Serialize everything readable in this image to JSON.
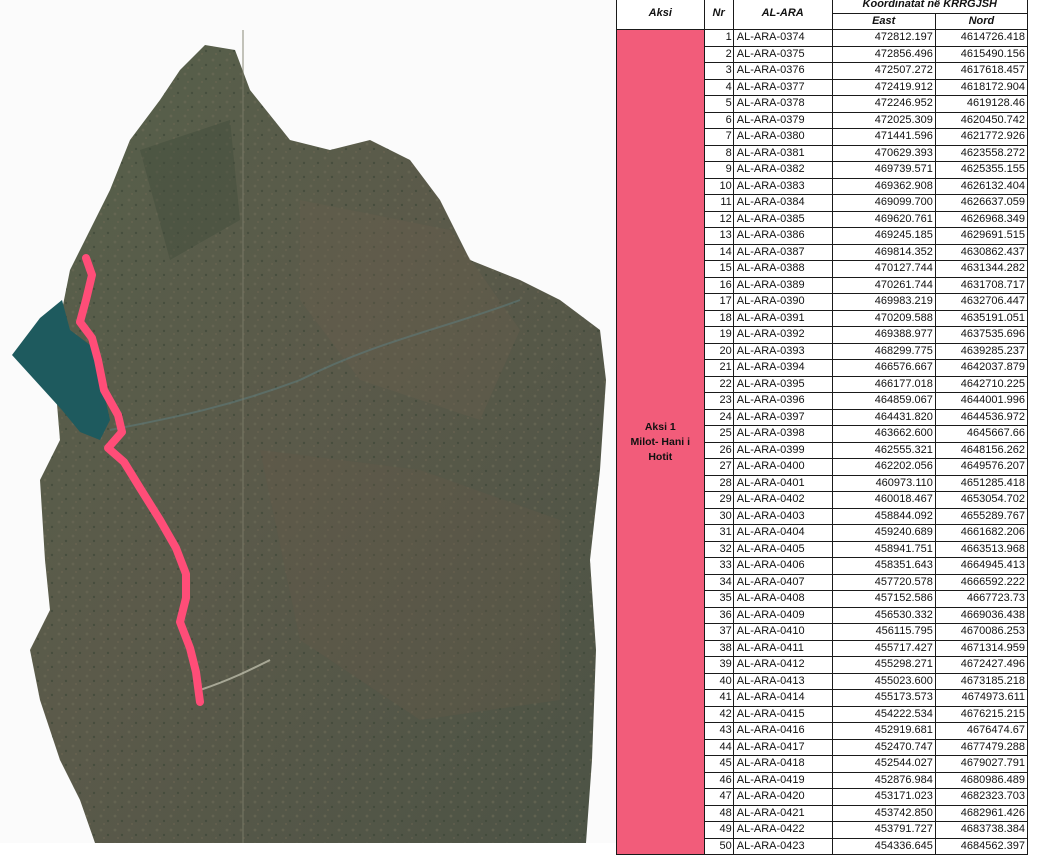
{
  "table": {
    "headers": {
      "aksi": "Aksi",
      "nr": "Nr",
      "ara": "AL-ARA",
      "coords": "Koordinatat në KRRGJSH",
      "east": "East",
      "nord": "Nord"
    },
    "group": {
      "line1": "Aksi 1",
      "line2": "Milot- Hani i",
      "line3": "Hotit"
    },
    "rows": [
      {
        "nr": "1",
        "id": "AL-ARA-0374",
        "east": "472812.197",
        "nord": "4614726.418"
      },
      {
        "nr": "2",
        "id": "AL-ARA-0375",
        "east": "472856.496",
        "nord": "4615490.156"
      },
      {
        "nr": "3",
        "id": "AL-ARA-0376",
        "east": "472507.272",
        "nord": "4617618.457"
      },
      {
        "nr": "4",
        "id": "AL-ARA-0377",
        "east": "472419.912",
        "nord": "4618172.904"
      },
      {
        "nr": "5",
        "id": "AL-ARA-0378",
        "east": "472246.952",
        "nord": "4619128.46"
      },
      {
        "nr": "6",
        "id": "AL-ARA-0379",
        "east": "472025.309",
        "nord": "4620450.742"
      },
      {
        "nr": "7",
        "id": "AL-ARA-0380",
        "east": "471441.596",
        "nord": "4621772.926"
      },
      {
        "nr": "8",
        "id": "AL-ARA-0381",
        "east": "470629.393",
        "nord": "4623558.272"
      },
      {
        "nr": "9",
        "id": "AL-ARA-0382",
        "east": "469739.571",
        "nord": "4625355.155"
      },
      {
        "nr": "10",
        "id": "AL-ARA-0383",
        "east": "469362.908",
        "nord": "4626132.404"
      },
      {
        "nr": "11",
        "id": "AL-ARA-0384",
        "east": "469099.700",
        "nord": "4626637.059"
      },
      {
        "nr": "12",
        "id": "AL-ARA-0385",
        "east": "469620.761",
        "nord": "4626968.349"
      },
      {
        "nr": "13",
        "id": "AL-ARA-0386",
        "east": "469245.185",
        "nord": "4629691.515"
      },
      {
        "nr": "14",
        "id": "AL-ARA-0387",
        "east": "469814.352",
        "nord": "4630862.437"
      },
      {
        "nr": "15",
        "id": "AL-ARA-0388",
        "east": "470127.744",
        "nord": "4631344.282"
      },
      {
        "nr": "16",
        "id": "AL-ARA-0389",
        "east": "470261.744",
        "nord": "4631708.717"
      },
      {
        "nr": "17",
        "id": "AL-ARA-0390",
        "east": "469983.219",
        "nord": "4632706.447"
      },
      {
        "nr": "18",
        "id": "AL-ARA-0391",
        "east": "470209.588",
        "nord": "4635191.051"
      },
      {
        "nr": "19",
        "id": "AL-ARA-0392",
        "east": "469388.977",
        "nord": "4637535.696"
      },
      {
        "nr": "20",
        "id": "AL-ARA-0393",
        "east": "468299.775",
        "nord": "4639285.237"
      },
      {
        "nr": "21",
        "id": "AL-ARA-0394",
        "east": "466576.667",
        "nord": "4642037.879"
      },
      {
        "nr": "22",
        "id": "AL-ARA-0395",
        "east": "466177.018",
        "nord": "4642710.225"
      },
      {
        "nr": "23",
        "id": "AL-ARA-0396",
        "east": "464859.067",
        "nord": "4644001.996"
      },
      {
        "nr": "24",
        "id": "AL-ARA-0397",
        "east": "464431.820",
        "nord": "4644536.972"
      },
      {
        "nr": "25",
        "id": "AL-ARA-0398",
        "east": "463662.600",
        "nord": "4645667.66"
      },
      {
        "nr": "26",
        "id": "AL-ARA-0399",
        "east": "462555.321",
        "nord": "4648156.262"
      },
      {
        "nr": "27",
        "id": "AL-ARA-0400",
        "east": "462202.056",
        "nord": "4649576.207"
      },
      {
        "nr": "28",
        "id": "AL-ARA-0401",
        "east": "460973.110",
        "nord": "4651285.418"
      },
      {
        "nr": "29",
        "id": "AL-ARA-0402",
        "east": "460018.467",
        "nord": "4653054.702"
      },
      {
        "nr": "30",
        "id": "AL-ARA-0403",
        "east": "458844.092",
        "nord": "4655289.767"
      },
      {
        "nr": "31",
        "id": "AL-ARA-0404",
        "east": "459240.689",
        "nord": "4661682.206"
      },
      {
        "nr": "32",
        "id": "AL-ARA-0405",
        "east": "458941.751",
        "nord": "4663513.968"
      },
      {
        "nr": "33",
        "id": "AL-ARA-0406",
        "east": "458351.643",
        "nord": "4664945.413"
      },
      {
        "nr": "34",
        "id": "AL-ARA-0407",
        "east": "457720.578",
        "nord": "4666592.222"
      },
      {
        "nr": "35",
        "id": "AL-ARA-0408",
        "east": "457152.586",
        "nord": "4667723.73"
      },
      {
        "nr": "36",
        "id": "AL-ARA-0409",
        "east": "456530.332",
        "nord": "4669036.438"
      },
      {
        "nr": "37",
        "id": "AL-ARA-0410",
        "east": "456115.795",
        "nord": "4670086.253"
      },
      {
        "nr": "38",
        "id": "AL-ARA-0411",
        "east": "455717.427",
        "nord": "4671314.959"
      },
      {
        "nr": "39",
        "id": "AL-ARA-0412",
        "east": "455298.271",
        "nord": "4672427.496"
      },
      {
        "nr": "40",
        "id": "AL-ARA-0413",
        "east": "455023.600",
        "nord": "4673185.218"
      },
      {
        "nr": "41",
        "id": "AL-ARA-0414",
        "east": "455173.573",
        "nord": "4674973.611"
      },
      {
        "nr": "42",
        "id": "AL-ARA-0415",
        "east": "454222.534",
        "nord": "4676215.215"
      },
      {
        "nr": "43",
        "id": "AL-ARA-0416",
        "east": "452919.681",
        "nord": "4676474.67"
      },
      {
        "nr": "44",
        "id": "AL-ARA-0417",
        "east": "452470.747",
        "nord": "4677479.288"
      },
      {
        "nr": "45",
        "id": "AL-ARA-0418",
        "east": "452544.027",
        "nord": "4679027.791"
      },
      {
        "nr": "46",
        "id": "AL-ARA-0419",
        "east": "452876.984",
        "nord": "4680986.489"
      },
      {
        "nr": "47",
        "id": "AL-ARA-0420",
        "east": "453171.023",
        "nord": "4682323.703"
      },
      {
        "nr": "48",
        "id": "AL-ARA-0421",
        "east": "453742.850",
        "nord": "4682961.426"
      },
      {
        "nr": "49",
        "id": "AL-ARA-0422",
        "east": "453791.727",
        "nord": "4683738.384"
      },
      {
        "nr": "50",
        "id": "AL-ARA-0423",
        "east": "454336.645",
        "nord": "4684562.397"
      }
    ]
  },
  "colors": {
    "route": "#ff4d78",
    "group_fill": "#f25c7a",
    "lake": "#1e5a5e",
    "terrain": "#4f5b44"
  }
}
